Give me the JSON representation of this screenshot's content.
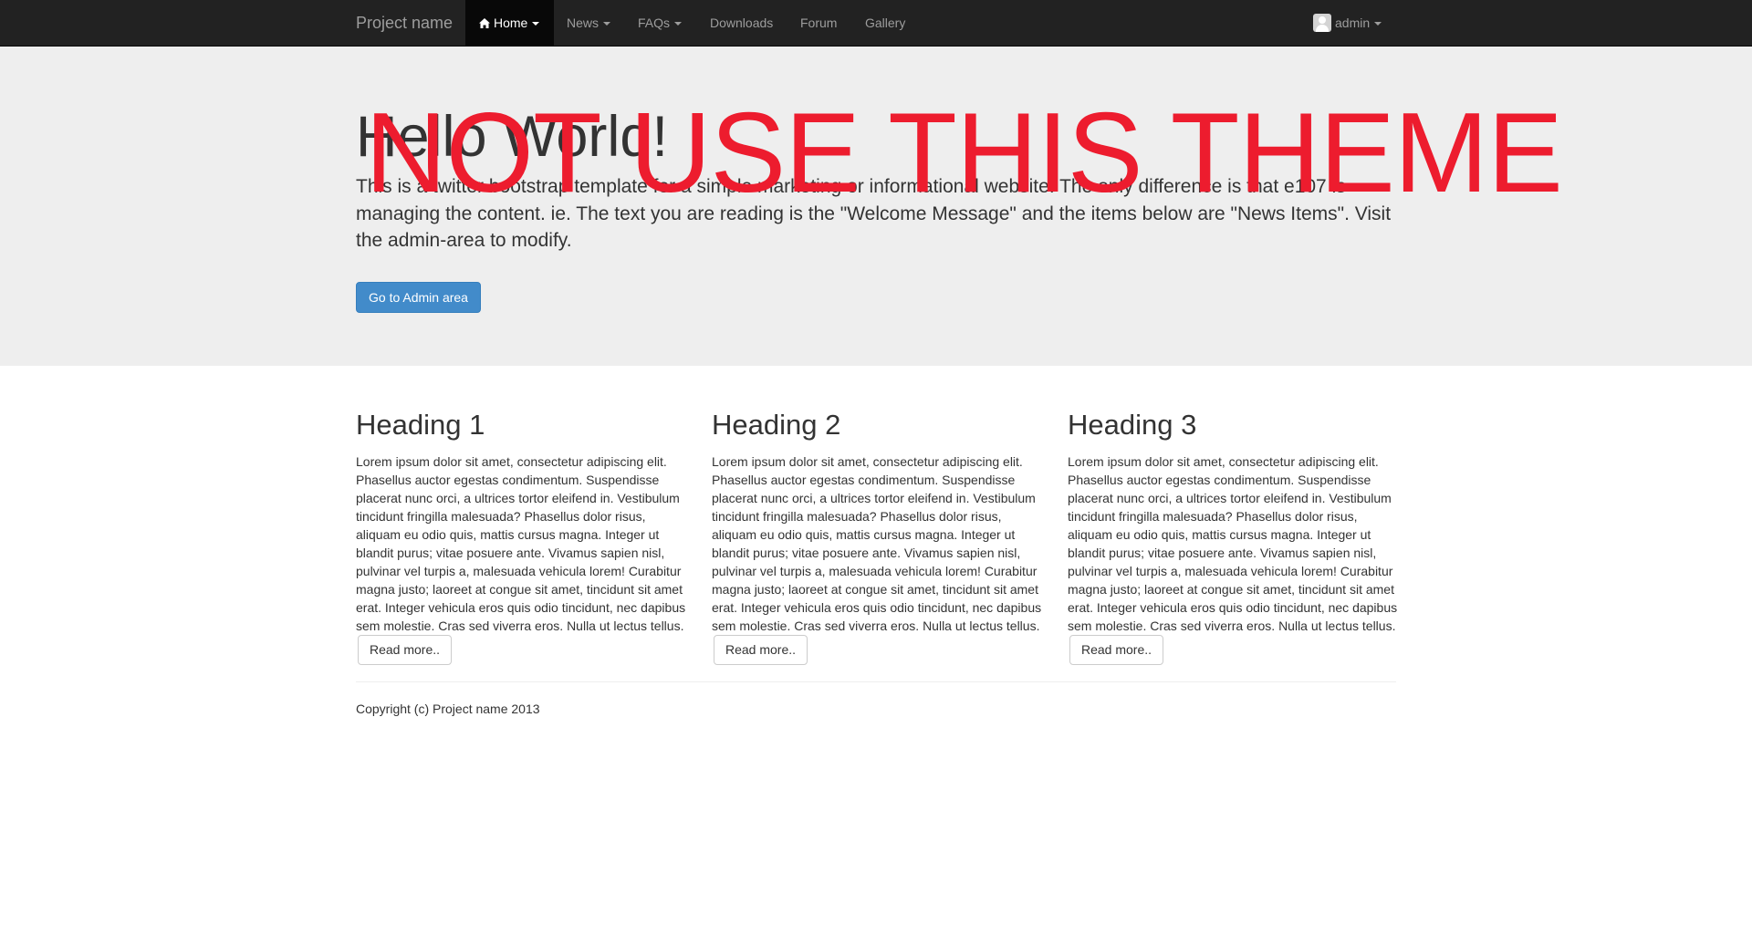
{
  "navbar": {
    "brand": "Project name",
    "items": [
      {
        "label": "Home",
        "icon": "home-icon",
        "dropdown": true,
        "active": true
      },
      {
        "label": "News",
        "dropdown": true
      },
      {
        "label": "FAQs",
        "dropdown": true
      },
      {
        "label": "Downloads",
        "dropdown": false
      },
      {
        "label": "Forum",
        "dropdown": false
      },
      {
        "label": "Gallery",
        "dropdown": false
      }
    ],
    "user": {
      "label": "admin",
      "icon": "avatar-icon"
    }
  },
  "jumbotron": {
    "title": "Hello World!",
    "text": "This is a twitter bootstrap template for a simple marketing or informational website. The only difference is that e107 is managing the content. ie. The text you are reading is the \"Welcome Message\" and the items below are \"News Items\". Visit the admin-area to modify.",
    "button": "Go to Admin area"
  },
  "overlay_text": "NOT USE THIS THEME",
  "columns": [
    {
      "heading": "Heading 1",
      "body": "Lorem ipsum dolor sit amet, consectetur adipiscing elit. Phasellus auctor egestas condimentum. Suspendisse placerat nunc orci, a ultrices tortor eleifend in. Vestibulum tincidunt fringilla malesuada? Phasellus dolor risus, aliquam eu odio quis, mattis cursus magna. Integer ut blandit purus; vitae posuere ante. Vivamus sapien nisl, pulvinar vel turpis a, malesuada vehicula lorem! Curabitur magna justo; laoreet at congue sit amet, tincidunt sit amet erat. Integer vehicula eros quis odio tincidunt, nec dapibus sem molestie. Cras sed viverra eros. Nulla ut lectus tellus.",
      "button": "Read more.."
    },
    {
      "heading": "Heading 2",
      "body": "Lorem ipsum dolor sit amet, consectetur adipiscing elit. Phasellus auctor egestas condimentum. Suspendisse placerat nunc orci, a ultrices tortor eleifend in. Vestibulum tincidunt fringilla malesuada? Phasellus dolor risus, aliquam eu odio quis, mattis cursus magna. Integer ut blandit purus; vitae posuere ante. Vivamus sapien nisl, pulvinar vel turpis a, malesuada vehicula lorem! Curabitur magna justo; laoreet at congue sit amet, tincidunt sit amet erat. Integer vehicula eros quis odio tincidunt, nec dapibus sem molestie. Cras sed viverra eros. Nulla ut lectus tellus.",
      "button": "Read more.."
    },
    {
      "heading": "Heading 3",
      "body": "Lorem ipsum dolor sit amet, consectetur adipiscing elit. Phasellus auctor egestas condimentum. Suspendisse placerat nunc orci, a ultrices tortor eleifend in. Vestibulum tincidunt fringilla malesuada? Phasellus dolor risus, aliquam eu odio quis, mattis cursus magna. Integer ut blandit purus; vitae posuere ante. Vivamus sapien nisl, pulvinar vel turpis a, malesuada vehicula lorem! Curabitur magna justo; laoreet at congue sit amet, tincidunt sit amet erat. Integer vehicula eros quis odio tincidunt, nec dapibus sem molestie. Cras sed viverra eros. Nulla ut lectus tellus.",
      "button": "Read more.."
    }
  ],
  "footer": {
    "copyright": "Copyright (c) Project name 2013"
  },
  "colors": {
    "navbar_bg": "#222222",
    "active_bg": "#080808",
    "jumbotron_bg": "#eeeeee",
    "primary": "#428bca",
    "overlay": "#ed1c2e"
  }
}
